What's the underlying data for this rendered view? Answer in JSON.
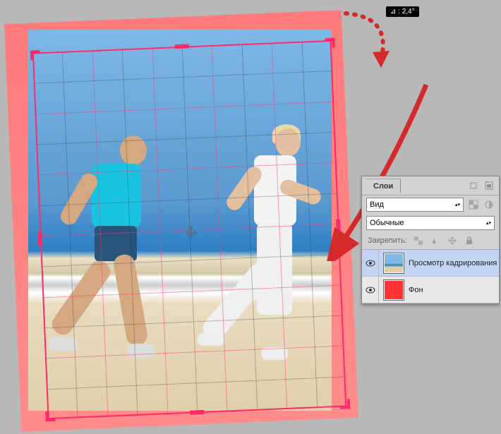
{
  "rotation_tooltip": "⊿ : 2,4°",
  "layers_panel": {
    "tab": "Слои",
    "kind_label": "Вид",
    "blend_mode": "Обычные",
    "lock_label": "Закрепить:",
    "items": [
      {
        "name": "Просмотр кадрирования",
        "selected": true,
        "thumb": "photo"
      },
      {
        "name": "Фон",
        "selected": false,
        "thumb": "red"
      }
    ]
  },
  "crop": {
    "grid_cols": 10,
    "grid_rows": 12
  }
}
